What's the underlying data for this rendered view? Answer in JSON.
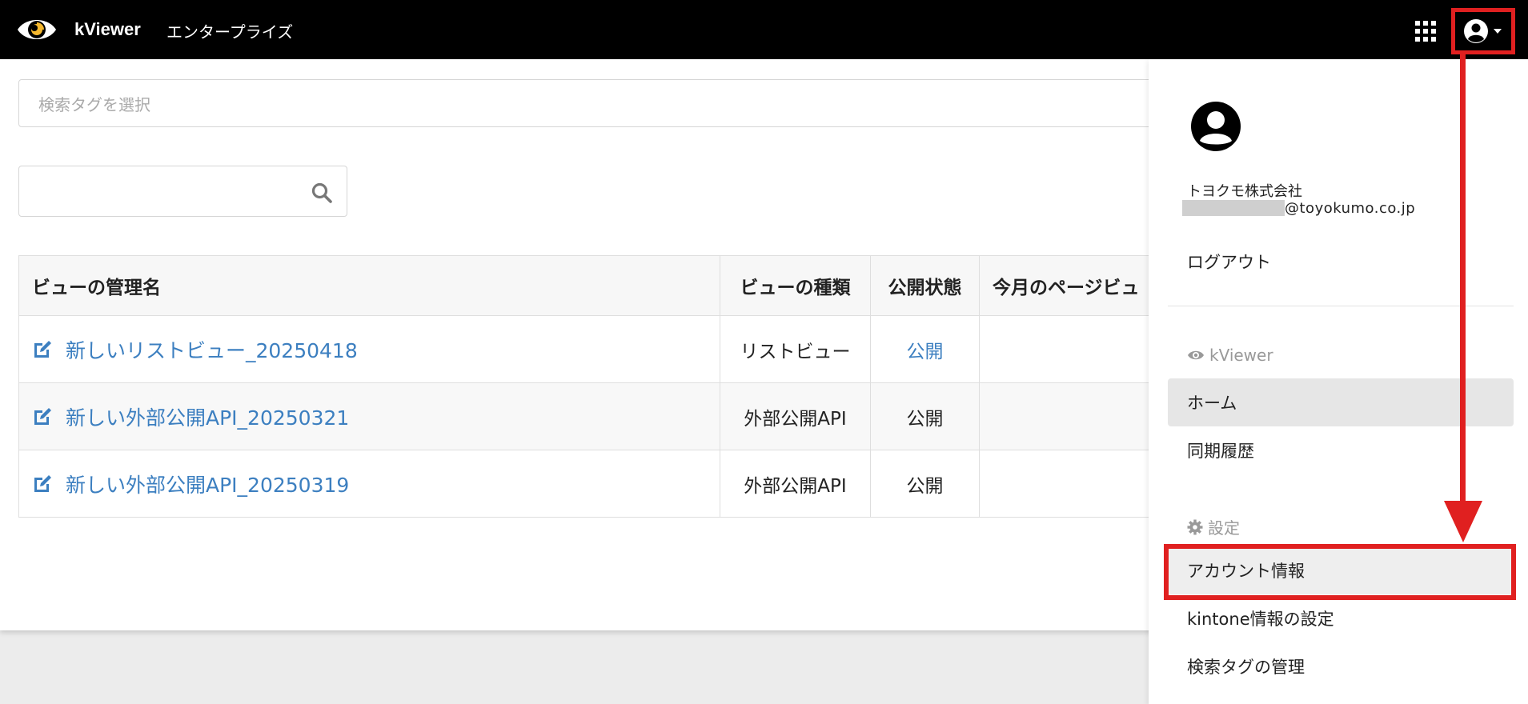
{
  "header": {
    "brand": "kViewer",
    "edition": "エンタープライズ"
  },
  "filters": {
    "tag_placeholder": "検索タグを選択"
  },
  "table": {
    "columns": [
      "ビューの管理名",
      "ビューの種類",
      "公開状態",
      "今月のページビュ"
    ],
    "rows": [
      {
        "name": "新しいリストビュー_20250418",
        "type": "リストビュー",
        "status": "公開"
      },
      {
        "name": "新しい外部公開API_20250321",
        "type": "外部公開API",
        "status": "公開"
      },
      {
        "name": "新しい外部公開API_20250319",
        "type": "外部公開API",
        "status": "公開"
      }
    ]
  },
  "user_menu": {
    "company": "トヨクモ株式会社",
    "email_domain": "@toyokumo.co.jp",
    "logout": "ログアウト",
    "section_kviewer": "kViewer",
    "home": "ホーム",
    "sync_history": "同期履歴",
    "section_settings": "設定",
    "account_info": "アカウント情報",
    "kintone_settings": "kintone情報の設定",
    "tag_management": "検索タグの管理"
  },
  "colors": {
    "link": "#3c7fc0",
    "annotation": "#e02020"
  }
}
